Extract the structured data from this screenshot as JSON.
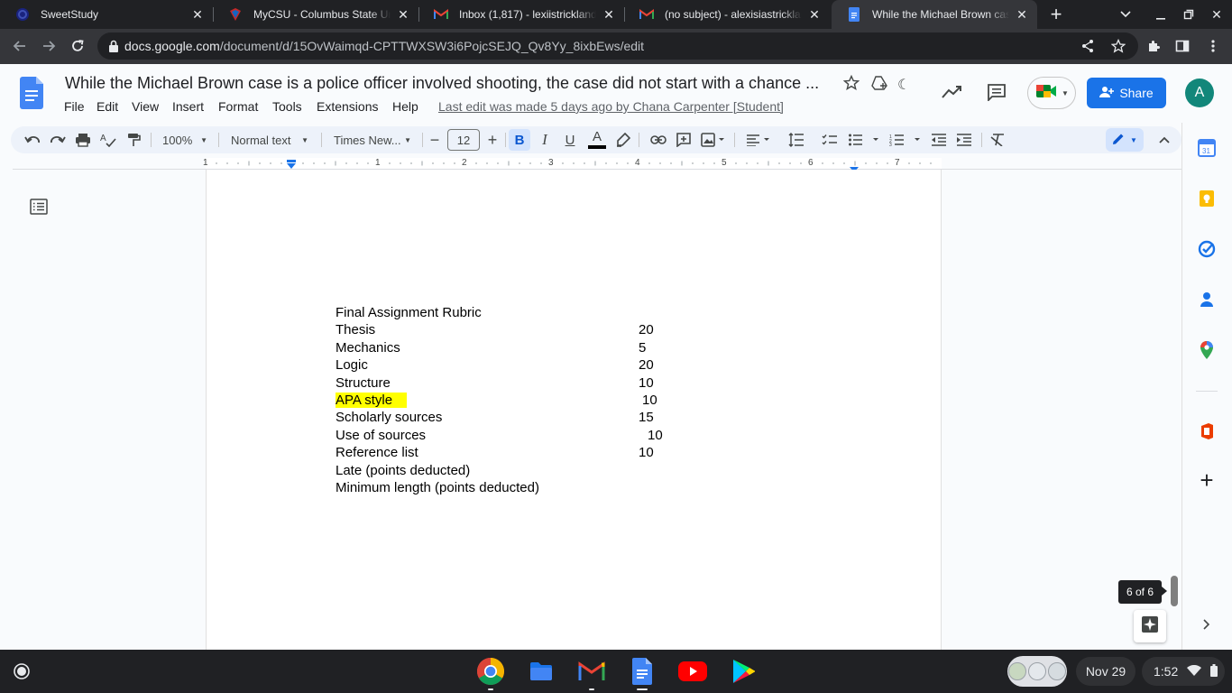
{
  "browser": {
    "tabs": [
      {
        "title": "SweetStudy",
        "icon": "sweetstudy-icon"
      },
      {
        "title": "MyCSU - Columbus State Univ",
        "icon": "mycsu-icon"
      },
      {
        "title": "Inbox (1,817) - lexiistrickland@",
        "icon": "gmail-icon"
      },
      {
        "title": "(no subject) - alexisiastricklanc",
        "icon": "gmail-icon"
      },
      {
        "title": "While the Michael Brown case",
        "icon": "docs-icon",
        "active": true
      }
    ],
    "url_host": "docs.google.com",
    "url_path": "/document/d/15OvWaimqd-CPTTWXSW3i6PojcSEJQ_Qv8Yy_8ixbEws/edit"
  },
  "docs": {
    "title": "While the Michael Brown case is a police officer involved shooting, the case did not start with a chance ...",
    "menu": [
      "File",
      "Edit",
      "View",
      "Insert",
      "Format",
      "Tools",
      "Extensions",
      "Help"
    ],
    "last_edit": "Last edit was made 5 days ago by Chana Carpenter [Student]",
    "share_label": "Share",
    "avatar_letter": "A"
  },
  "toolbar": {
    "zoom": "100%",
    "style": "Normal text",
    "font": "Times New...",
    "font_size": "12"
  },
  "ruler": {
    "numbers": [
      "1",
      "1",
      "2",
      "3",
      "4",
      "5",
      "6",
      "7"
    ]
  },
  "document": {
    "heading": "Final Assignment Rubric",
    "rows": [
      {
        "label": "Thesis",
        "points": "20"
      },
      {
        "label": "Mechanics",
        "points": "5"
      },
      {
        "label": "Logic",
        "points": "20"
      },
      {
        "label": "Structure",
        "points": "10"
      },
      {
        "label": "APA style",
        "points": "10",
        "highlight": true
      },
      {
        "label": "Scholarly sources",
        "points": "15"
      },
      {
        "label": "Use of sources",
        "points": "10"
      },
      {
        "label": "Reference list",
        "points": "10"
      },
      {
        "label": "Late (points deducted)",
        "points": ""
      },
      {
        "label": "Minimum length (points deducted)",
        "points": ""
      }
    ]
  },
  "page_indicator": "6 of 6",
  "shelf": {
    "date": "Nov 29",
    "time": "1:52"
  }
}
